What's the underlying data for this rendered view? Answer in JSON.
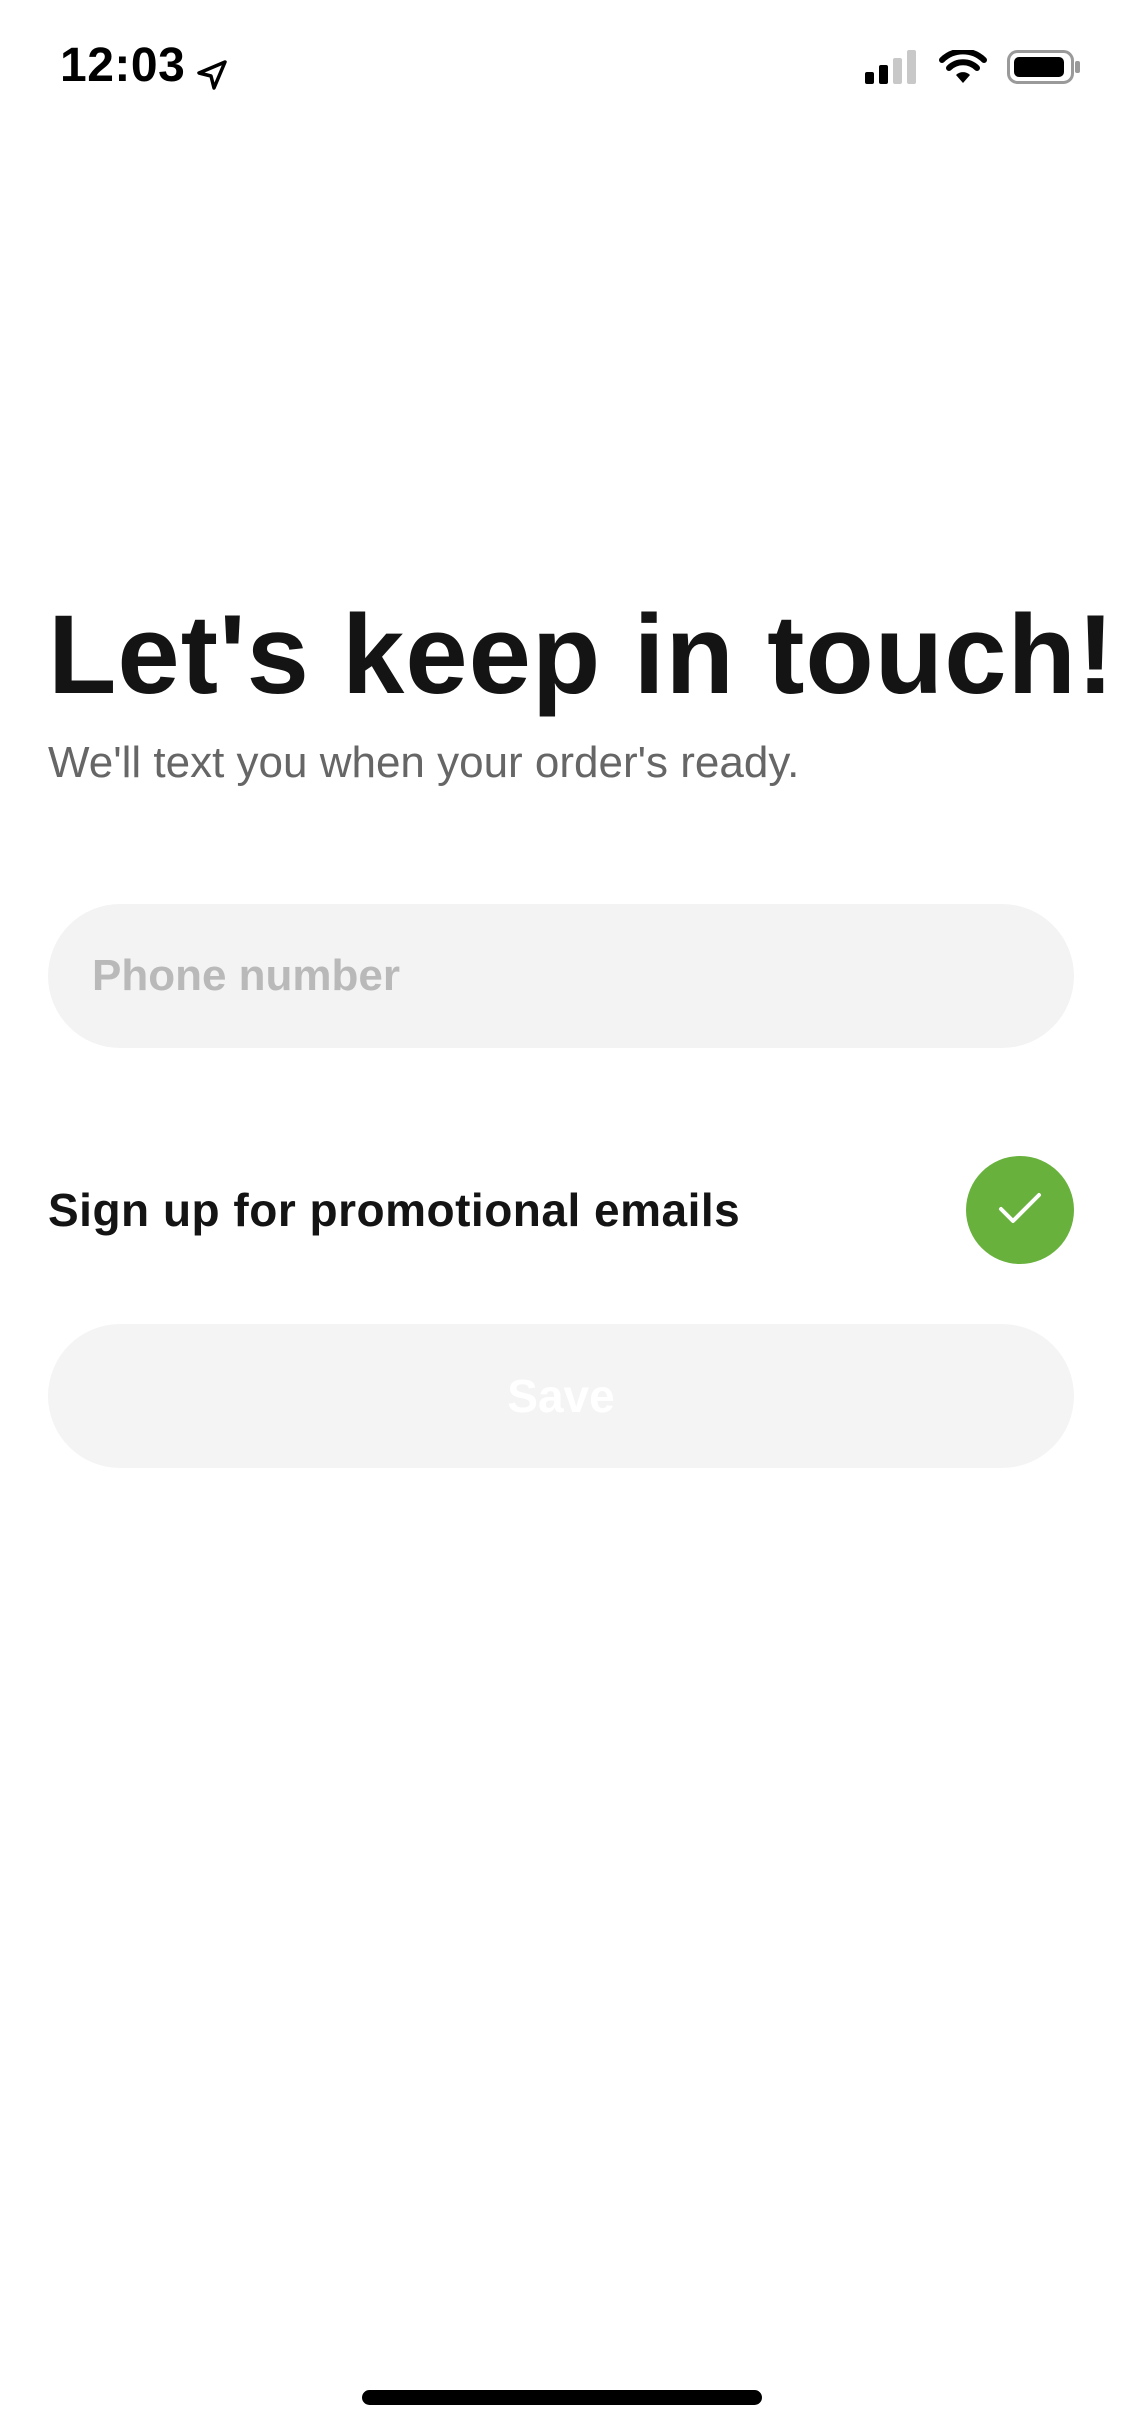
{
  "status_bar": {
    "time": "12:03",
    "location_icon": "location-arrow-icon",
    "signal_icon": "cellular-signal-icon",
    "wifi_icon": "wifi-icon",
    "battery_icon": "battery-icon"
  },
  "content": {
    "title": "Let's keep in touch!",
    "subtitle": "We'll text you when your order's ready.",
    "phone_input": {
      "value": "",
      "placeholder": "Phone number"
    },
    "promo_toggle": {
      "label": "Sign up for promotional emails",
      "checked": true,
      "icon": "checkmark-icon"
    },
    "save_button": {
      "label": "Save",
      "enabled": false
    }
  },
  "colors": {
    "accent_green": "#68b13d",
    "title_text": "#141414",
    "subtitle_text": "#666666",
    "field_background": "#f3f3f3",
    "placeholder_text": "#b9b9b9",
    "disabled_button_text": "#ffffff"
  }
}
